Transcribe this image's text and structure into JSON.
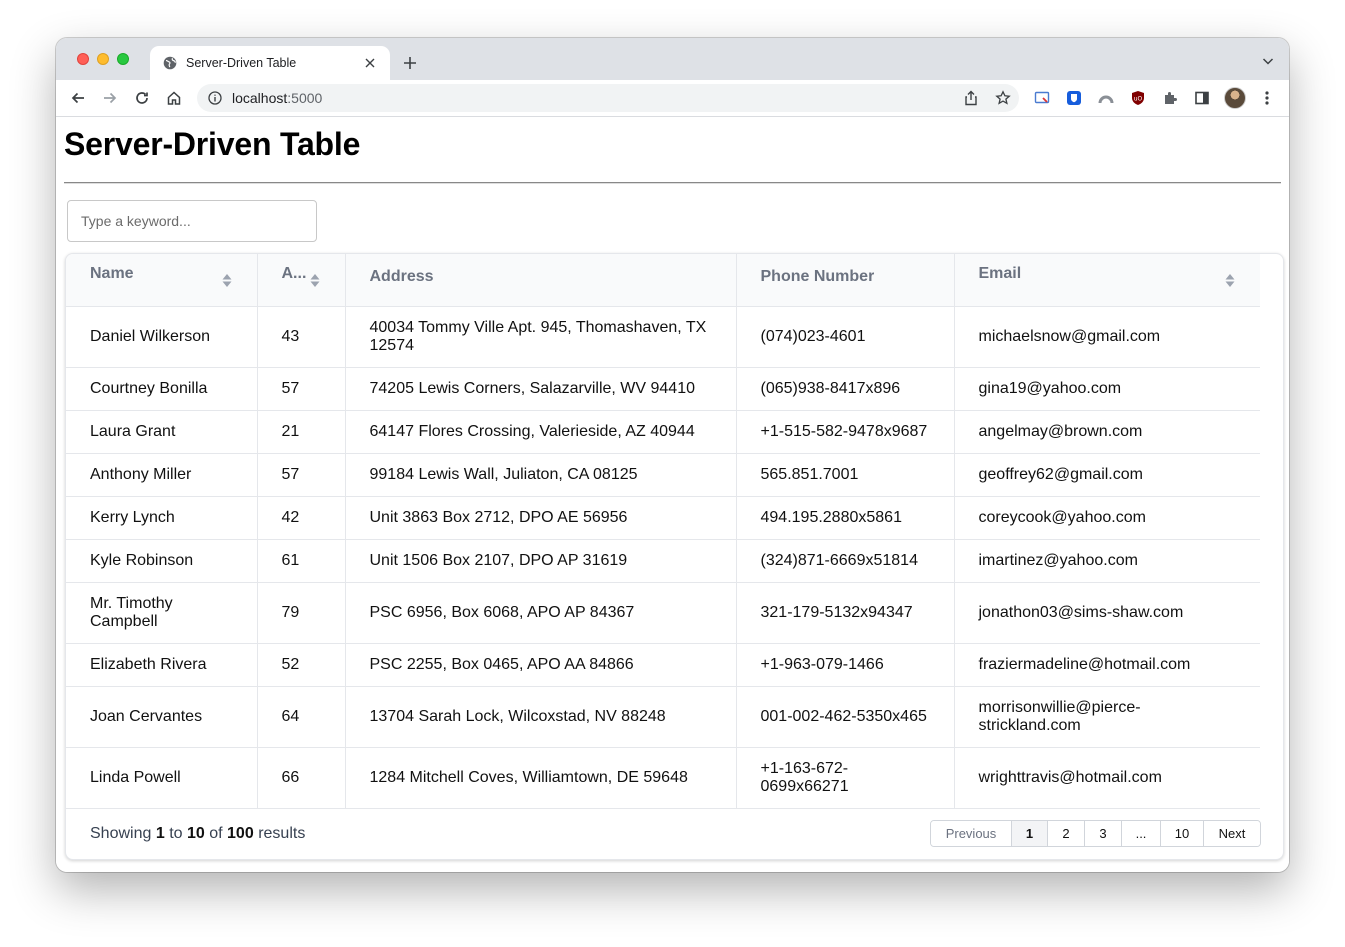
{
  "browser": {
    "tab_title": "Server-Driven Table",
    "url_host": "localhost",
    "url_port": ":5000"
  },
  "page": {
    "title": "Server-Driven Table",
    "search_placeholder": "Type a keyword..."
  },
  "table": {
    "columns": [
      {
        "label": "Name",
        "sortable": true
      },
      {
        "label": "A...",
        "sortable": true
      },
      {
        "label": "Address",
        "sortable": false
      },
      {
        "label": "Phone Number",
        "sortable": false
      },
      {
        "label": "Email",
        "sortable": true
      }
    ],
    "rows": [
      {
        "name": "Daniel Wilkerson",
        "age": "43",
        "address": "40034 Tommy Ville Apt. 945, Thomashaven, TX 12574",
        "phone": "(074)023-4601",
        "email": "michaelsnow@gmail.com"
      },
      {
        "name": "Courtney Bonilla",
        "age": "57",
        "address": "74205 Lewis Corners, Salazarville, WV 94410",
        "phone": "(065)938-8417x896",
        "email": "gina19@yahoo.com"
      },
      {
        "name": "Laura Grant",
        "age": "21",
        "address": "64147 Flores Crossing, Valerieside, AZ 40944",
        "phone": "+1-515-582-9478x9687",
        "email": "angelmay@brown.com"
      },
      {
        "name": "Anthony Miller",
        "age": "57",
        "address": "99184 Lewis Wall, Juliaton, CA 08125",
        "phone": "565.851.7001",
        "email": "geoffrey62@gmail.com"
      },
      {
        "name": "Kerry Lynch",
        "age": "42",
        "address": "Unit 3863 Box 2712, DPO AE 56956",
        "phone": "494.195.2880x5861",
        "email": "coreycook@yahoo.com"
      },
      {
        "name": "Kyle Robinson",
        "age": "61",
        "address": "Unit 1506 Box 2107, DPO AP 31619",
        "phone": "(324)871-6669x51814",
        "email": "imartinez@yahoo.com"
      },
      {
        "name": "Mr. Timothy Campbell",
        "age": "79",
        "address": "PSC 6956, Box 6068, APO AP 84367",
        "phone": "321-179-5132x94347",
        "email": "jonathon03@sims-shaw.com"
      },
      {
        "name": "Elizabeth Rivera",
        "age": "52",
        "address": "PSC 2255, Box 0465, APO AA 84866",
        "phone": "+1-963-079-1466",
        "email": "fraziermadeline@hotmail.com"
      },
      {
        "name": "Joan Cervantes",
        "age": "64",
        "address": "13704 Sarah Lock, Wilcoxstad, NV 88248",
        "phone": "001-002-462-5350x465",
        "email": "morrisonwillie@pierce-strickland.com"
      },
      {
        "name": "Linda Powell",
        "age": "66",
        "address": "1284 Mitchell Coves, Williamtown, DE 59648",
        "phone": "+1-163-672-0699x66271",
        "email": "wrighttravis@hotmail.com"
      }
    ]
  },
  "footer": {
    "showing_prefix": "Showing",
    "from": "1",
    "to_word": "to",
    "to": "10",
    "of_word": "of",
    "total": "100",
    "results_word": "results"
  },
  "pagination": {
    "previous": "Previous",
    "pages": [
      "1",
      "2",
      "3",
      "...",
      "10"
    ],
    "current": "1",
    "next": "Next"
  }
}
